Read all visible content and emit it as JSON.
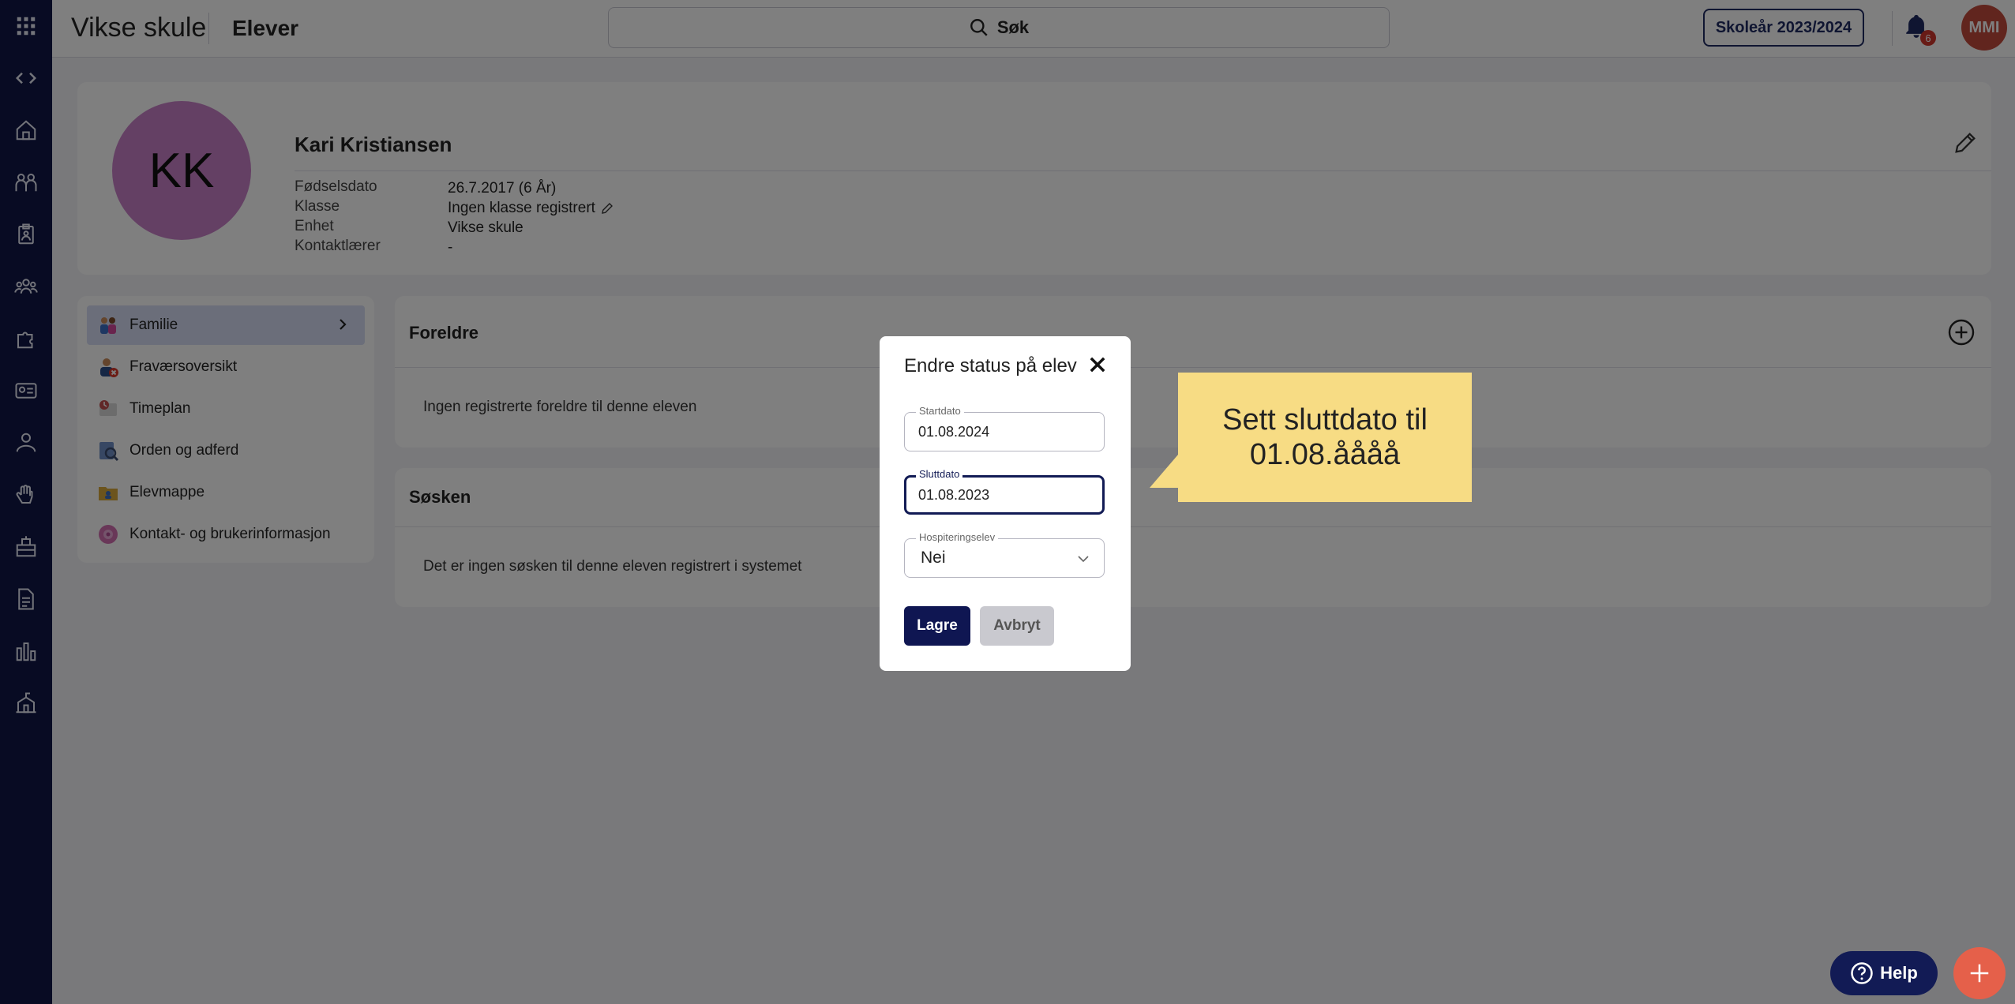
{
  "app": {
    "title": "Vikse skule",
    "section": "Elever"
  },
  "search": {
    "label": "Søk"
  },
  "header": {
    "school_year": "Skoleår 2023/2024",
    "notification_count": "6",
    "user_initials": "MMI"
  },
  "sidebar": {
    "icons": [
      "apps-grid-icon",
      "expand-collapse-icon",
      "home-icon",
      "students-icon",
      "clipboard-icon",
      "groups-icon",
      "puzzle-icon",
      "id-card-icon",
      "person-icon",
      "hand-icon",
      "building-icon",
      "document-icon",
      "bar-chart-icon",
      "school-icon"
    ]
  },
  "student": {
    "initials": "KK",
    "name": "Kari Kristiansen",
    "fields": [
      {
        "label": "Fødselsdato",
        "value": "26.7.2017 (6 År)"
      },
      {
        "label": "Klasse",
        "value": "Ingen klasse registrert"
      },
      {
        "label": "Enhet",
        "value": "Vikse skule"
      },
      {
        "label": "Kontaktlærer",
        "value": "-"
      }
    ]
  },
  "menu": {
    "items": [
      {
        "label": "Familie",
        "icon": "family-icon",
        "active": true
      },
      {
        "label": "Fraværsoversikt",
        "icon": "absence-icon"
      },
      {
        "label": "Timeplan",
        "icon": "schedule-icon"
      },
      {
        "label": "Orden og adferd",
        "icon": "conduct-icon"
      },
      {
        "label": "Elevmappe",
        "icon": "folder-icon"
      },
      {
        "label": "Kontakt- og brukerinformasjon",
        "icon": "contact-info-icon"
      }
    ]
  },
  "panels": {
    "parents": {
      "title": "Foreldre",
      "empty_text": "Ingen registrerte foreldre til denne eleven"
    },
    "siblings": {
      "title": "Søsken",
      "empty_text": "Det er ingen søsken til denne eleven registrert i systemet"
    }
  },
  "modal": {
    "title": "Endre status på elev",
    "start_date": {
      "label": "Startdato",
      "value": "01.08.2024"
    },
    "end_date": {
      "label": "Sluttdato",
      "value": "01.08.2023"
    },
    "hospitation": {
      "label": "Hospiteringselev",
      "value": "Nei"
    },
    "save_label": "Lagre",
    "cancel_label": "Avbryt"
  },
  "callout": {
    "line1": "Sett sluttdato til",
    "line2": "01.08.åååå"
  },
  "help": {
    "label": "Help"
  },
  "colors": {
    "sidebar": "#101746",
    "primary": "#0f1652",
    "avatar": "#c981c8",
    "user_avatar": "#c24a3c",
    "callout": "#f7dc84",
    "fab": "#e5604a"
  }
}
